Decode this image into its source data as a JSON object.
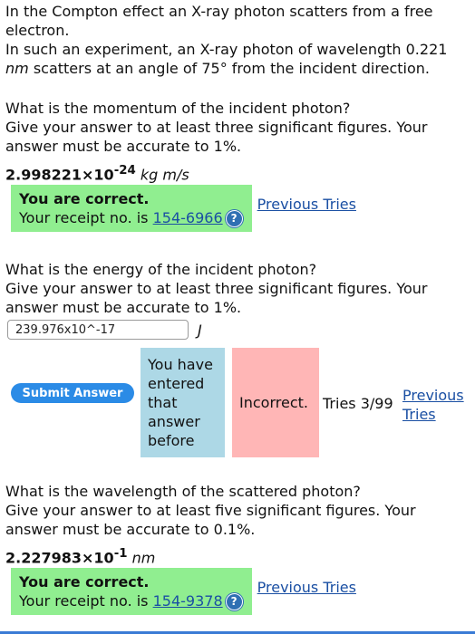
{
  "intro": {
    "line1": "In the Compton effect an X-ray photon scatters from a free electron.",
    "line2a": "In such an experiment, an X-ray photon of wavelength 0.221",
    "line2b_unit": "nm",
    "line2c": " scatters at an angle of 75° from the incident direction."
  },
  "q1": {
    "question": "What is the momentum of the incident photon?",
    "instruction": "Give your answer to at least three significant figures. Your answer must be accurate to 1%.",
    "answer_mantissa": "2.998221×10",
    "answer_exponent": "-24",
    "answer_unit": "kg m/s",
    "correct_title": "You are correct.",
    "receipt_prefix": "Your receipt no. is ",
    "receipt_no": "154-6966",
    "help_glyph": "?",
    "previous_tries": "Previous Tries"
  },
  "q2": {
    "question": "What is the energy of the incident photon?",
    "instruction": "Give your answer to at least three significant figures. Your answer must be accurate to 1%.",
    "input_value": "239.976x10^-17",
    "input_unit": "J",
    "submit_label": "Submit Answer",
    "entered_note": "You have entered that answer before",
    "status": "Incorrect.",
    "tries": "Tries 3/99",
    "previous_tries": "Previous Tries"
  },
  "q3": {
    "question": "What is the wavelength of the scattered photon?",
    "instruction": "Give your answer to at least five significant figures. Your answer must be accurate to 0.1%.",
    "answer_mantissa": "2.227983×10",
    "answer_exponent": "-1",
    "answer_unit": "nm",
    "correct_title": "You are correct.",
    "receipt_prefix": "Your receipt no. is ",
    "receipt_no": "154-9378",
    "help_glyph": "?",
    "previous_tries": "Previous Tries"
  },
  "colors": {
    "correct_bg": "#90ee90",
    "entered_bg": "#add8e6",
    "incorrect_bg": "#ffb6b6",
    "link": "#1a4fa3",
    "button": "#2b8be6"
  },
  "icons": {
    "help": "help-icon"
  }
}
